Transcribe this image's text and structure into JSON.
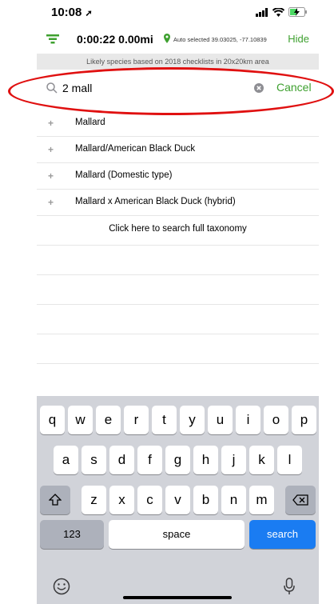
{
  "status": {
    "time": "10:08"
  },
  "topbar": {
    "timer": "0:00:22",
    "distance": "0.00mi",
    "location": "Auto selected 39.03025, -77.10839",
    "hide_label": "Hide"
  },
  "banner": {
    "text": "Likely species based on 2018 checklists in 20x20km area"
  },
  "search": {
    "value": "2 mall",
    "cancel_label": "Cancel"
  },
  "results": [
    {
      "name": "Mallard"
    },
    {
      "name": "Mallard/American Black Duck"
    },
    {
      "name": "Mallard (Domestic type)"
    },
    {
      "name": "Mallard x American Black Duck (hybrid)"
    }
  ],
  "full_search_label": "Click here to search full taxonomy",
  "keyboard": {
    "row1": [
      "q",
      "w",
      "e",
      "r",
      "t",
      "y",
      "u",
      "i",
      "o",
      "p"
    ],
    "row2": [
      "a",
      "s",
      "d",
      "f",
      "g",
      "h",
      "j",
      "k",
      "l"
    ],
    "row3": [
      "z",
      "x",
      "c",
      "v",
      "b",
      "n",
      "m"
    ],
    "numbers_label": "123",
    "space_label": "space",
    "search_label": "search"
  },
  "colors": {
    "accent": "#3ea02f",
    "highlight": "#e01010",
    "keyboard_search": "#1a7cf2"
  }
}
